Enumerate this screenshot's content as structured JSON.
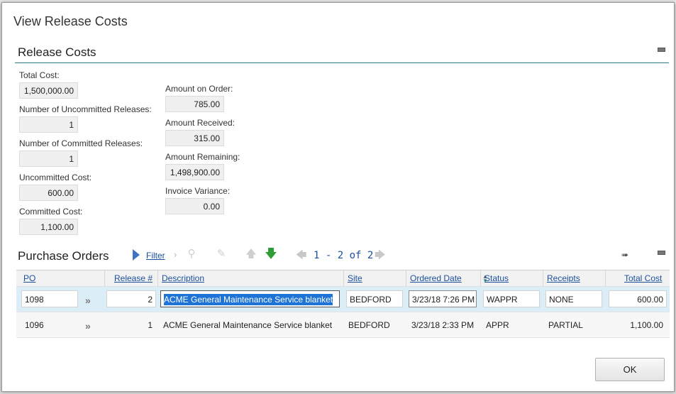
{
  "dialog": {
    "title": "View Release Costs",
    "ok_label": "OK"
  },
  "release_costs": {
    "section_title": "Release Costs",
    "left_fields": [
      {
        "label": "Total Cost:",
        "value": "1,500,000.00"
      },
      {
        "label": "Number of Uncommitted Releases:",
        "value": "1"
      },
      {
        "label": "Number of Committed Releases:",
        "value": "1"
      },
      {
        "label": "Uncommitted Cost:",
        "value": "600.00"
      },
      {
        "label": "Committed Cost:",
        "value": "1,100.00"
      }
    ],
    "right_fields": [
      {
        "label": "Amount on Order:",
        "value": "785.00"
      },
      {
        "label": "Amount Received:",
        "value": "315.00"
      },
      {
        "label": "Amount Remaining:",
        "value": "1,498,900.00"
      },
      {
        "label": "Invoice Variance:",
        "value": "0.00"
      }
    ]
  },
  "purchase_orders": {
    "section_title": "Purchase Orders",
    "filter_label": "Filter",
    "pager_text": "1 - 2 of 2",
    "columns": [
      "PO",
      "Release #",
      "Description",
      "Site",
      "Ordered Date",
      "Status",
      "Receipts",
      "Total Cost"
    ],
    "rows": [
      {
        "po": "1098",
        "release": "2",
        "description": "ACME General Maintenance Service blanket",
        "site": "BEDFORD",
        "ordered_date": "3/23/18 7:26 PM",
        "status": "WAPPR",
        "receipts": "NONE",
        "total_cost": "600.00"
      },
      {
        "po": "1096",
        "release": "1",
        "description": "ACME General Maintenance Service blanket",
        "site": "BEDFORD",
        "ordered_date": "3/23/18 2:33 PM",
        "status": "APPR",
        "receipts": "PARTIAL",
        "total_cost": "1,100.00"
      }
    ]
  },
  "icons": {
    "filter": "filter-arrow-icon",
    "search": "search-icon",
    "clear": "eraser-icon",
    "sort_up": "arrow-up-icon",
    "sort_down": "arrow-down-icon",
    "prev": "arrow-left-icon",
    "next": "arrow-right-icon",
    "export": "download-icon",
    "minimize": "minimize-icon",
    "row_details": "double-chevron-icon"
  },
  "colors": {
    "accent": "#2d7b84",
    "link": "#1a4f9c",
    "selected_row": "#dbeef7",
    "selection": "#1e74d6",
    "green_arrow": "#2f9d36"
  }
}
